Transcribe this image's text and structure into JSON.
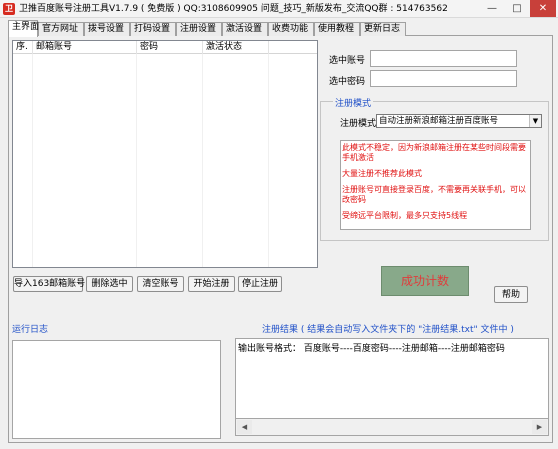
{
  "window": {
    "title": "卫推百度账号注册工具V1.7.9 ( 免费版 )    QQ:3108609905 问题_技巧_新版发布_交流QQ群 : 514763562",
    "icon_text": "卫",
    "min": "—",
    "max": "□",
    "close": "✕"
  },
  "tabs": [
    "主界面",
    "官方网址",
    "拨号设置",
    "打码设置",
    "注册设置",
    "激活设置",
    "收费功能",
    "使用教程",
    "更新日志"
  ],
  "grid": {
    "columns": [
      "序.",
      "邮箱账号",
      "密码",
      "激活状态"
    ]
  },
  "buttons": {
    "import": "导入163邮箱账号",
    "delete": "删除选中",
    "clear": "清空账号",
    "start": "开始注册",
    "stop": "停止注册",
    "help": "帮助"
  },
  "fields": {
    "account_label": "选中账号",
    "password_label": "选中密码"
  },
  "mode": {
    "group_title": "注册模式",
    "label": "注册模式",
    "selected": "自动注册新浪邮箱注册百度账号",
    "notes": [
      "此模式不稳定，因为新浪邮箱注册在某些时间段需要手机激活",
      "大量注册不推荐此模式",
      "注册账号可直接登录百度，不需要再关联手机，可以改密码",
      "受缔远平台限制，最多只支持5线程"
    ]
  },
  "success_counter": "成功计数",
  "log": {
    "title": "运行日志"
  },
  "results": {
    "title": "注册结果 ( 结果会自动写入文件夹下的 \"注册结果.txt\" 文件中 )",
    "format": "输出账号格式： 百度账号----百度密码----注册邮箱----注册邮箱密码"
  },
  "scroll": {
    "left": "◀",
    "right": "▶"
  },
  "colors": {
    "section_title": "#2050c8",
    "note_text": "#e01010",
    "success_bg": "#88a98a",
    "success_text": "#e03b3b"
  }
}
